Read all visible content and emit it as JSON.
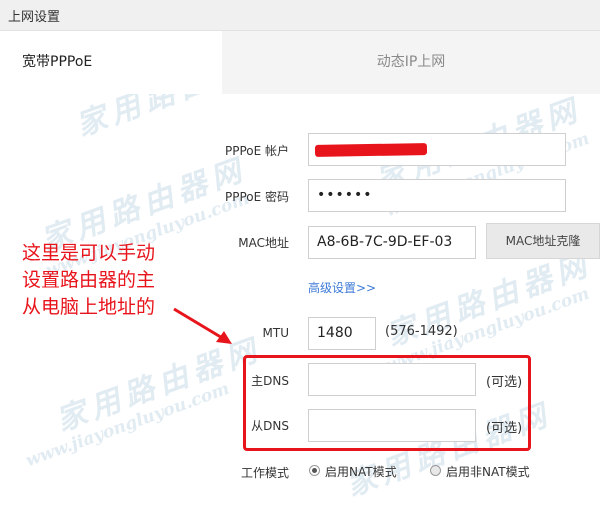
{
  "window": {
    "title": "上网设置"
  },
  "tabs": [
    {
      "label": "宽带PPPoE",
      "active": true
    },
    {
      "label": "动态IP上网",
      "active": false
    }
  ],
  "form": {
    "account": {
      "label": "PPPoE 帐户",
      "value": ""
    },
    "password": {
      "label": "PPPoE 密码",
      "value": "••••••"
    },
    "mac": {
      "label": "MAC地址",
      "value": "A8-6B-7C-9D-EF-03",
      "clone_button": "MAC地址克隆"
    },
    "advanced_link": "高级设置>>",
    "mtu": {
      "label": "MTU",
      "value": "1480",
      "range": "(576-1492)"
    },
    "primary_dns": {
      "label": "主DNS",
      "value": "",
      "optional": "(可选)"
    },
    "secondary_dns": {
      "label": "从DNS",
      "value": "",
      "optional": "(可选)"
    },
    "work_mode": {
      "label": "工作模式",
      "options": [
        {
          "label": "启用NAT模式",
          "selected": true
        },
        {
          "label": "启用非NAT模式",
          "selected": false
        }
      ]
    }
  },
  "annotation": {
    "lines": [
      "这里是可以手动",
      "设置路由器的主",
      "从电脑上地址的"
    ],
    "color": "#e8141c"
  },
  "watermark": {
    "cn": "家用路由器网",
    "en": "www.jiayongluyou.com"
  },
  "colors": {
    "highlight": "#e8141c",
    "link": "#3d7ad6"
  }
}
